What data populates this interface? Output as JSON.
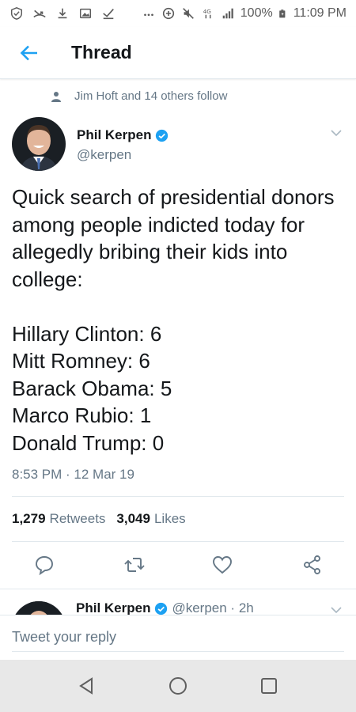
{
  "status_bar": {
    "icons": [
      "shield-check-icon",
      "missed-call-icon",
      "download-icon",
      "gallery-icon",
      "check-icon",
      "more-dots-icon",
      "data-saver-icon",
      "mute-icon",
      "4g-icon",
      "signal-icon",
      "battery-icon"
    ],
    "battery": "100%",
    "time": "11:09 PM",
    "network": "4G"
  },
  "header": {
    "title": "Thread",
    "back_icon": "arrow-left-icon"
  },
  "social_context": {
    "icon": "person-icon",
    "text": "Jim Hoft and 14 others follow"
  },
  "tweet": {
    "author_name": "Phil Kerpen",
    "handle": "@kerpen",
    "verified": true,
    "text": "Quick search of presidential donors among people indicted today for allegedly bribing their kids into college:\n\nHillary Clinton: 6\nMitt Romney: 6\nBarack Obama: 5\nMarco Rubio: 1\nDonald Trump: 0",
    "timestamp": "8:53 PM · 12 Mar 19",
    "retweets_count": "1,279",
    "retweets_label": "Retweets",
    "likes_count": "3,049",
    "likes_label": "Likes"
  },
  "actions": [
    "reply-icon",
    "retweet-icon",
    "like-icon",
    "share-icon"
  ],
  "next_tweet": {
    "author_name": "Phil Kerpen",
    "meta": "@kerpen · 2h"
  },
  "reply": {
    "placeholder": "Tweet your reply"
  },
  "nav": [
    "back-triangle-icon",
    "home-circle-icon",
    "recents-square-icon"
  ],
  "colors": {
    "accent": "#1da1f2",
    "text_primary": "#14171a",
    "text_secondary": "#657786",
    "divider": "#e1e8ed",
    "nav_bg": "#e8e8e8"
  }
}
